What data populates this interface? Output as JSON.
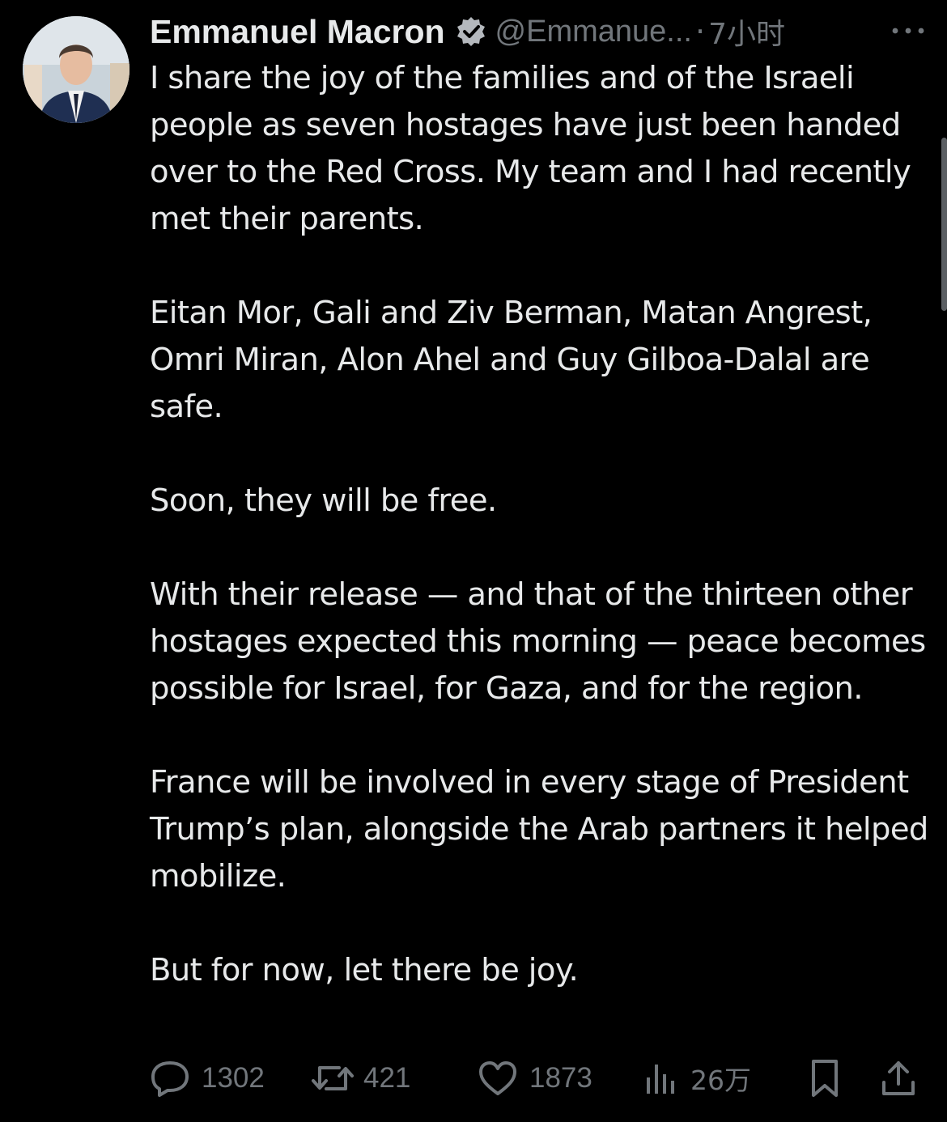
{
  "author": {
    "name": "Emmanuel Macron",
    "handle": "@Emmanue...",
    "separator": "·",
    "time": "7小时"
  },
  "tweet": {
    "paragraphs": [
      "I share the joy of the families and of the Israeli people as seven hostages have just been handed over to the Red Cross. My team and I had recently met their parents.",
      "Eitan Mor, Gali and Ziv Berman, Matan Angrest, Omri Miran, Alon Ahel and Guy Gilboa-Dalal are safe.",
      "Soon, they will be free.",
      "With their release — and that of the thirteen other hostages expected this morning — peace becomes possible for Israel, for Gaza, and for the region.",
      "France will be involved in every stage of President Trump’s plan, alongside the Arab partners it helped mobilize.",
      "But for now, let there be joy."
    ]
  },
  "actions": {
    "replies": "1302",
    "reposts": "421",
    "likes": "1873",
    "views": "26万"
  },
  "icons": {
    "more": "more-dots-icon",
    "verified": "verified-badge-icon",
    "reply": "reply-icon",
    "repost": "repost-icon",
    "like": "heart-icon",
    "views": "views-chart-icon",
    "bookmark": "bookmark-icon",
    "share": "share-icon"
  },
  "colors": {
    "background": "#000000",
    "text": "#e7e9ea",
    "muted": "#71767b"
  }
}
